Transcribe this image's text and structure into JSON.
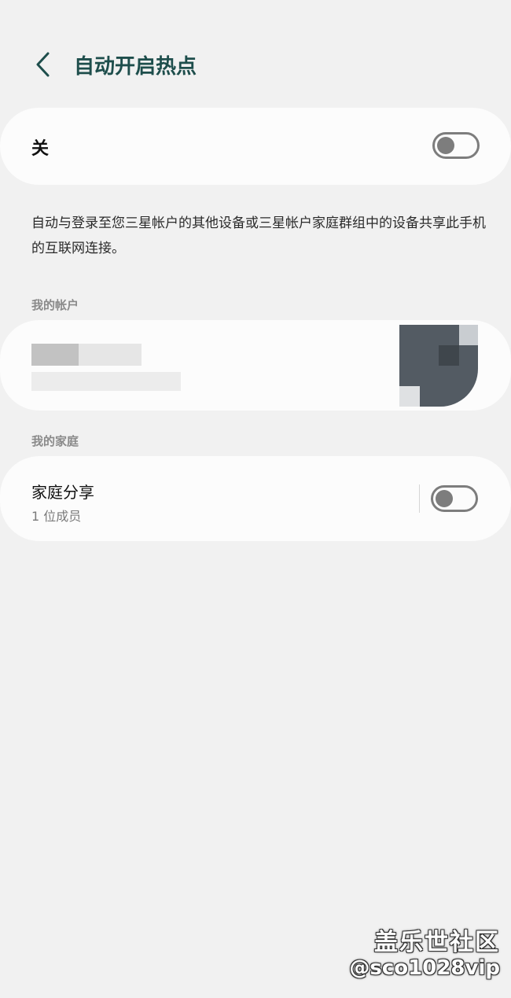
{
  "header": {
    "back_icon": "chevron-left-icon",
    "title": "自动开启热点"
  },
  "master_switch": {
    "label": "关",
    "state": "off"
  },
  "description": "自动与登录至您三星帐户的其他设备或三星帐户家庭群组中的设备共享此手机的互联网连接。",
  "my_account": {
    "section_label": "我的帐户"
  },
  "my_family": {
    "section_label": "我的家庭",
    "item_title": "家庭分享",
    "item_subtitle": "1 位成员",
    "toggle_state": "off"
  },
  "watermark": {
    "line1": "盖乐世社区",
    "line2": "@sco1028vip"
  },
  "colors": {
    "background": "#f1f1f1",
    "card": "#fcfcfc",
    "title": "#1e4e4c",
    "toggle_off": "#7d7d7d",
    "section_label": "#8a8a8a"
  }
}
